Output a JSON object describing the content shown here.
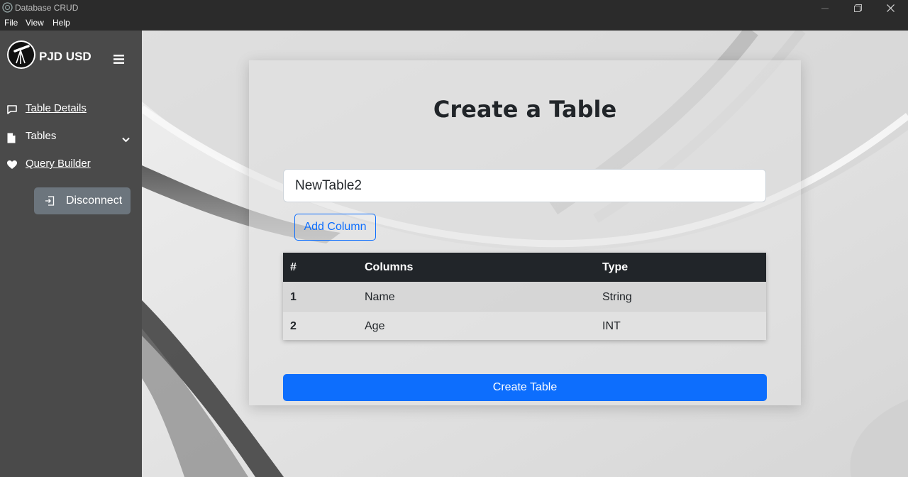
{
  "window": {
    "title": "Database CRUD"
  },
  "menu": {
    "items": [
      "File",
      "View",
      "Help"
    ]
  },
  "sidebar": {
    "brand": "PJD USD",
    "items": [
      {
        "label": "Table Details",
        "icon": "chat-square-icon"
      },
      {
        "label": "Tables",
        "icon": "file-icon"
      },
      {
        "label": "Query Builder",
        "icon": "heart-icon"
      }
    ],
    "disconnect_label": "Disconnect"
  },
  "main": {
    "title": "Create a Table",
    "table_name_value": "NewTable2",
    "add_column_label": "Add Column",
    "table": {
      "headers": [
        "#",
        "Columns",
        "Type"
      ],
      "rows": [
        [
          "1",
          "Name",
          "String"
        ],
        [
          "2",
          "Age",
          "INT"
        ]
      ]
    },
    "create_label": "Create Table"
  },
  "colors": {
    "primary": "#0d6efd",
    "sidebar": "#4a4a4a",
    "table_header": "#212529",
    "secondary_button": "#6c757d"
  }
}
